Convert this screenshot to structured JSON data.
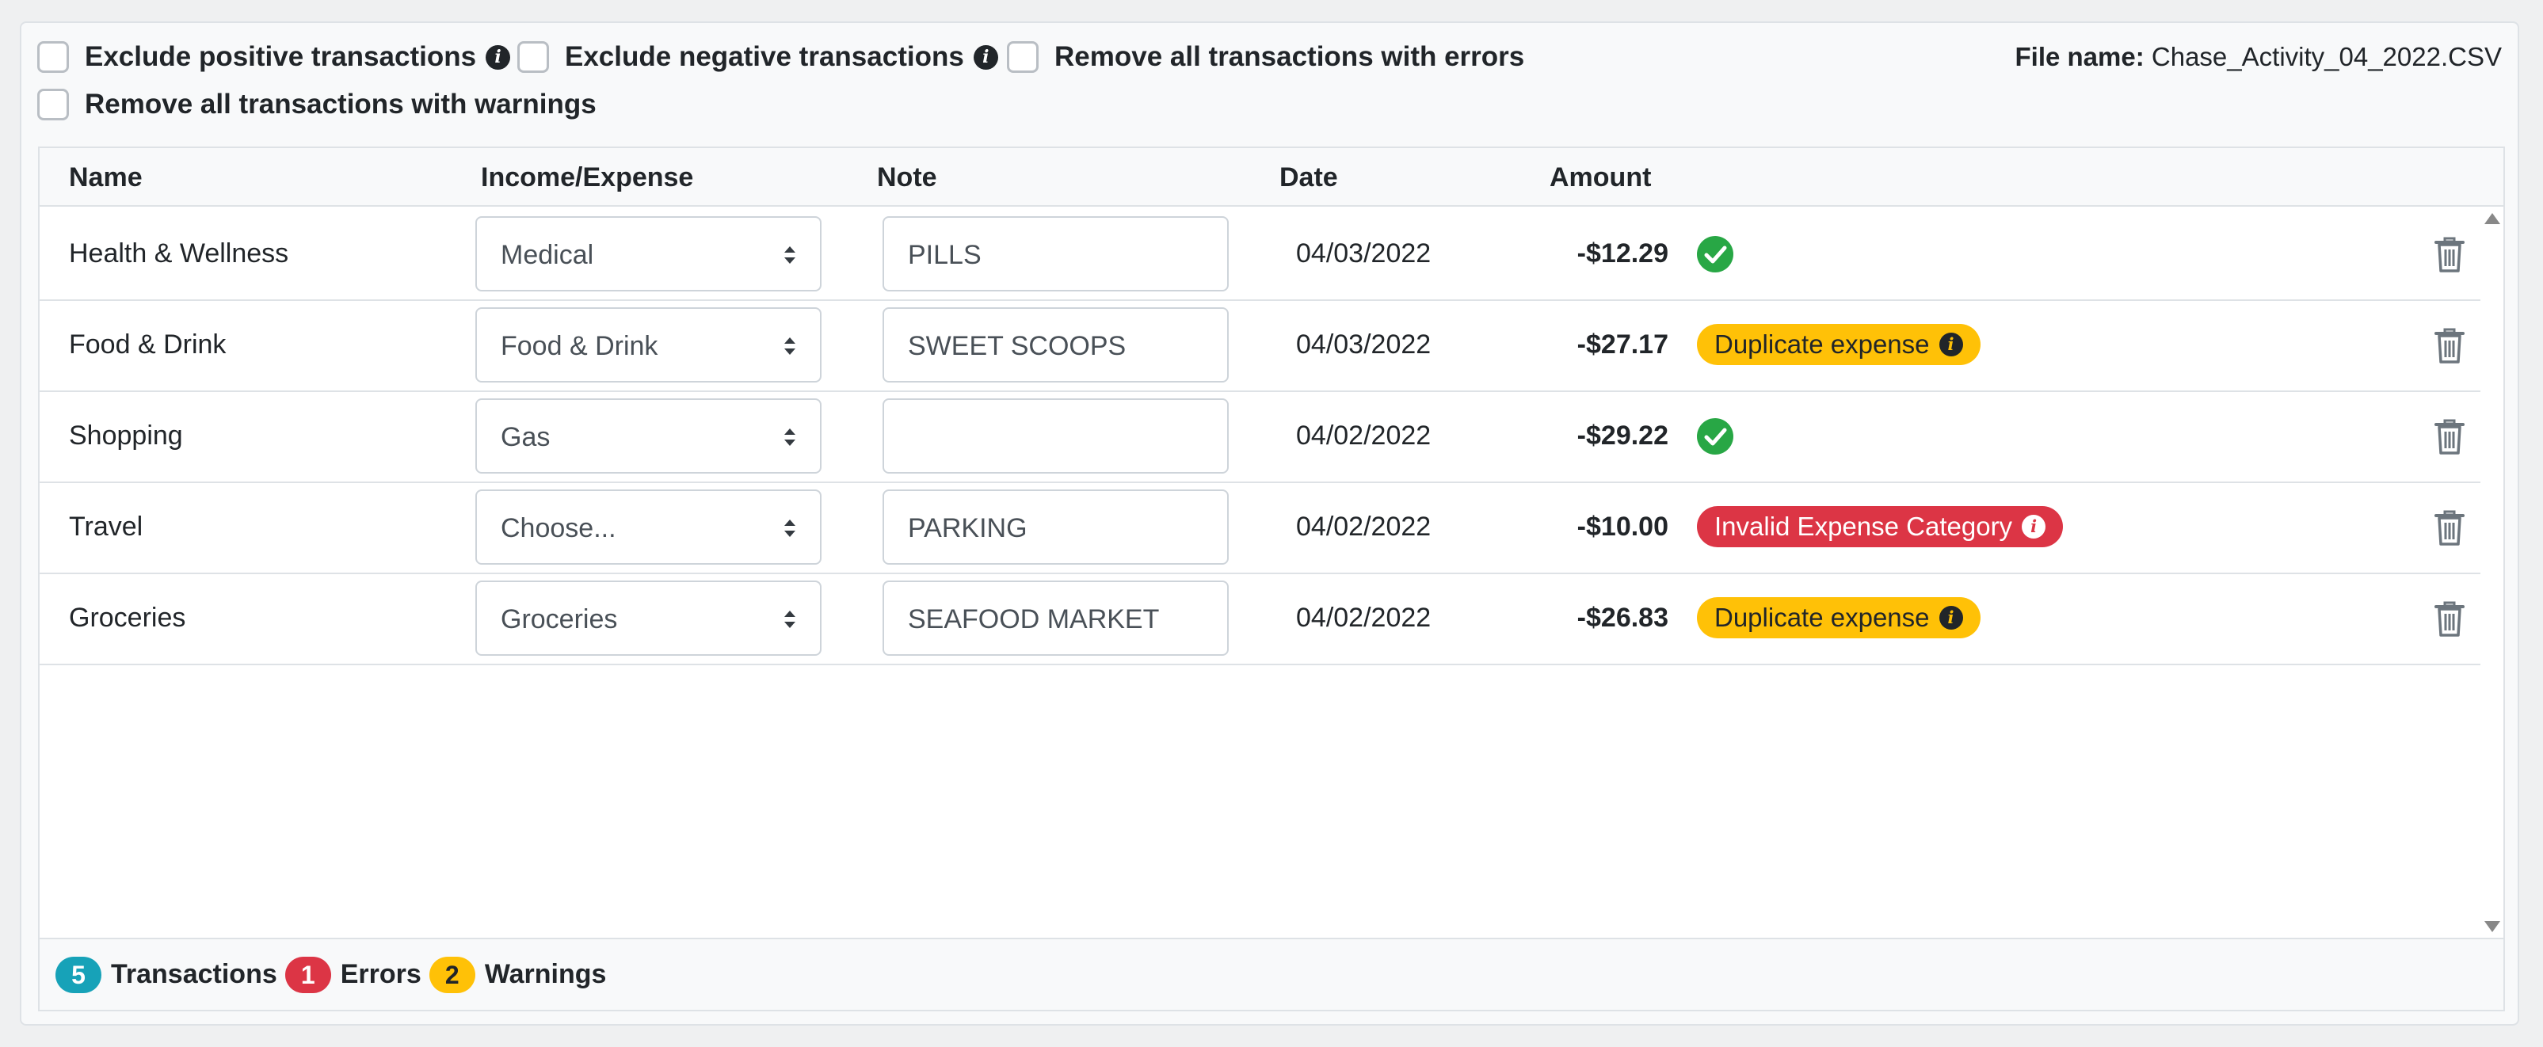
{
  "options": {
    "exclude_positive": "Exclude positive transactions",
    "exclude_negative": "Exclude negative transactions",
    "remove_errors": "Remove all transactions with errors",
    "remove_warnings": "Remove all transactions with warnings"
  },
  "file": {
    "label": "File name:",
    "value": "Chase_Activity_04_2022.CSV"
  },
  "table": {
    "headers": {
      "name": "Name",
      "income_expense": "Income/Expense",
      "note": "Note",
      "date": "Date",
      "amount": "Amount"
    },
    "rows": [
      {
        "name": "Health & Wellness",
        "category": "Medical",
        "note": "PILLS",
        "date": "04/03/2022",
        "amount": "-$12.29",
        "status": "ok"
      },
      {
        "name": "Food & Drink",
        "category": "Food & Drink",
        "note": "SWEET SCOOPS",
        "date": "04/03/2022",
        "amount": "-$27.17",
        "status": "warning",
        "badge": "Duplicate expense"
      },
      {
        "name": "Shopping",
        "category": "Gas",
        "note": "",
        "date": "04/02/2022",
        "amount": "-$29.22",
        "status": "ok"
      },
      {
        "name": "Travel",
        "category": "Choose...",
        "note": "PARKING",
        "date": "04/02/2022",
        "amount": "-$10.00",
        "status": "error",
        "badge": "Invalid Expense Category"
      },
      {
        "name": "Groceries",
        "category": "Groceries",
        "note": "SEAFOOD MARKET",
        "date": "04/02/2022",
        "amount": "-$26.83",
        "status": "warning",
        "badge": "Duplicate expense"
      }
    ]
  },
  "footer": {
    "transactions_count": "5",
    "transactions_label": "Transactions",
    "errors_count": "1",
    "errors_label": "Errors",
    "warnings_count": "2",
    "warnings_label": "Warnings"
  },
  "colors": {
    "success": "#28a745",
    "warning": "#ffc107",
    "danger": "#dc3545",
    "info": "#17a2b8"
  }
}
